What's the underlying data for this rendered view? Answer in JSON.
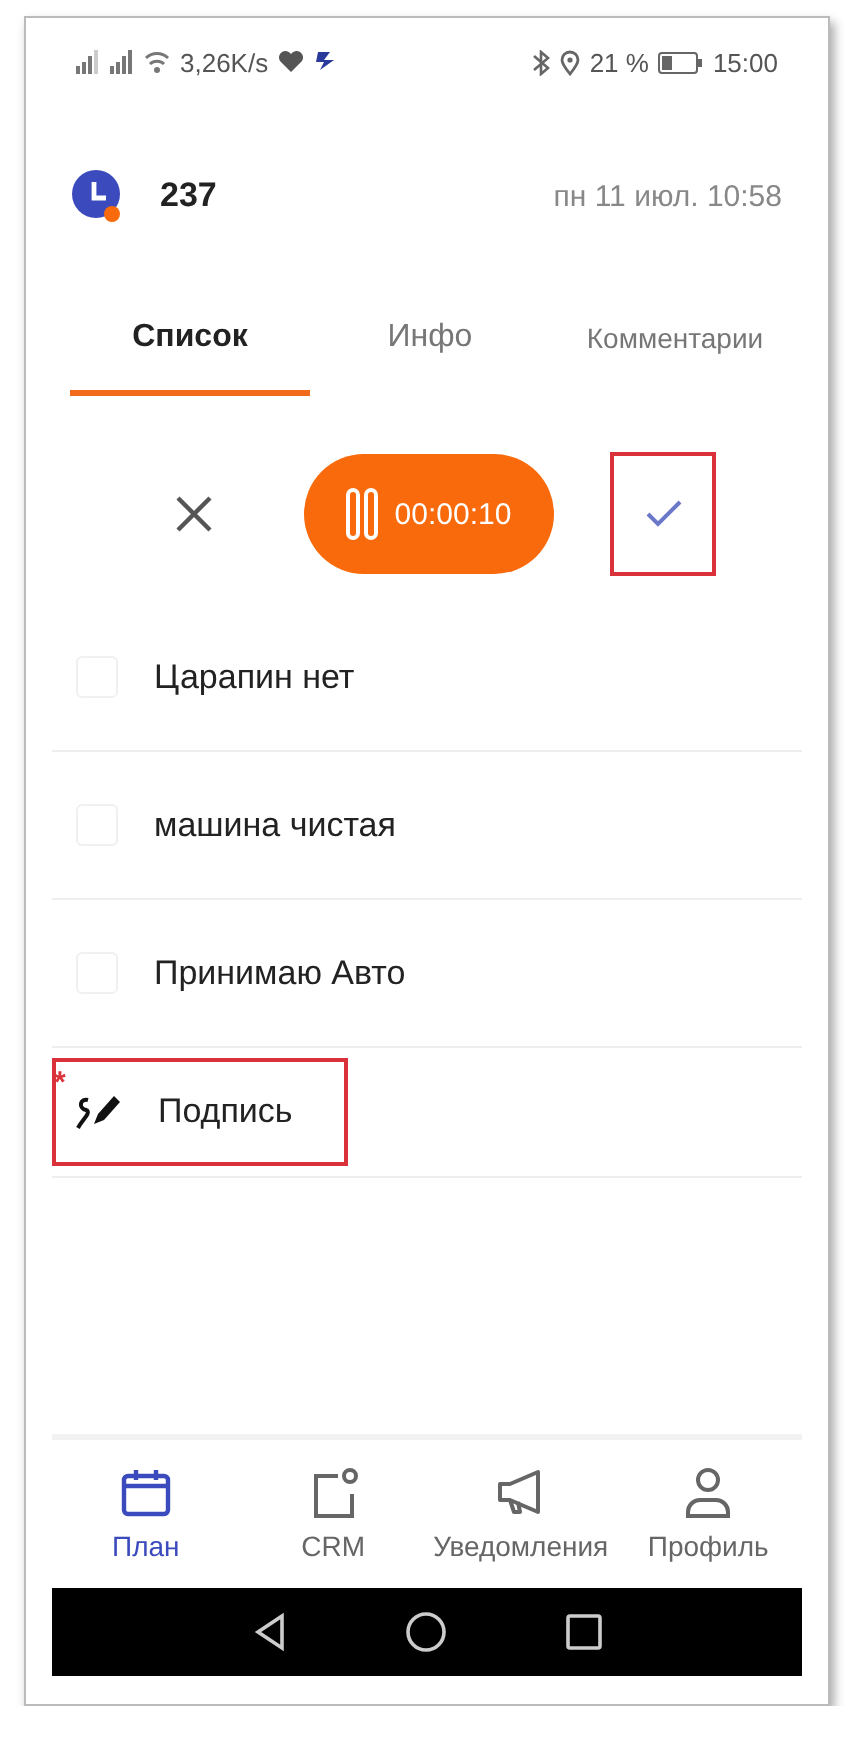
{
  "status_bar": {
    "speed": "3,26K/s",
    "battery": "21 %",
    "time": "15:00"
  },
  "header": {
    "number": "237",
    "datetime": "пн 11 июл. 10:58"
  },
  "tabs": [
    {
      "label": "Список",
      "selected": true
    },
    {
      "label": "Инфо",
      "selected": false
    },
    {
      "label": "Комментарии",
      "selected": false
    }
  ],
  "timer": {
    "elapsed": "00:00:10",
    "confirm_highlighted": true
  },
  "items": [
    {
      "kind": "checkbox",
      "label": "Царапин нет",
      "checked": false
    },
    {
      "kind": "checkbox",
      "label": "машина чистая",
      "checked": false
    },
    {
      "kind": "checkbox",
      "label": "Принимаю Авто",
      "checked": false
    },
    {
      "kind": "signature",
      "label": "Подпись",
      "marker": "*",
      "highlighted": true
    }
  ],
  "nav": [
    {
      "label": "План",
      "kind": "calendar",
      "selected": true
    },
    {
      "label": "CRM",
      "kind": "crm",
      "selected": false
    },
    {
      "label": "Уведомления",
      "kind": "megaphone",
      "selected": false
    },
    {
      "label": "Профиль",
      "kind": "person",
      "selected": false
    }
  ]
}
